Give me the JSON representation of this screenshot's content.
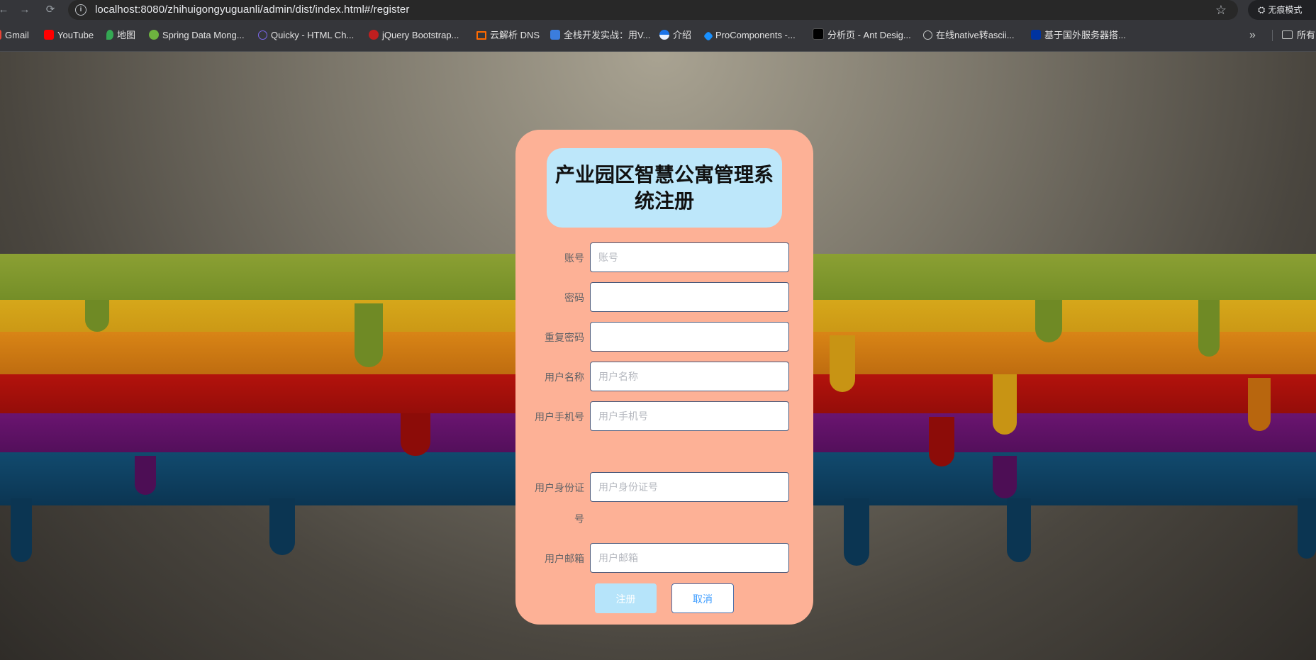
{
  "browser": {
    "url": "localhost:8080/zhihuigongyuguanli/admin/dist/index.html#/register",
    "incognito_label": "无痕模式",
    "bookmarks": [
      {
        "label": "Gmail",
        "icon": "gmail-icon",
        "color": "#ea4335"
      },
      {
        "label": "YouTube",
        "icon": "youtube-icon",
        "color": "#ff0000"
      },
      {
        "label": "地图",
        "icon": "maps-icon",
        "color": "#34a853"
      },
      {
        "label": "Spring Data Mong...",
        "icon": "spring-icon",
        "color": "#6db33f"
      },
      {
        "label": "Quicky - HTML Ch...",
        "icon": "quicky-icon",
        "color": "#6f42c1"
      },
      {
        "label": "jQuery Bootstrap...",
        "icon": "jquery-icon",
        "color": "#c01f1f"
      },
      {
        "label": "云解析 DNS",
        "icon": "aliyun-icon",
        "color": "#ff6a00"
      },
      {
        "label": "全栈开发实战：用V...",
        "icon": "m-icon",
        "color": "#3b7ddd"
      },
      {
        "label": "介绍",
        "icon": "globe-blue-icon",
        "color": "#1a73e8"
      },
      {
        "label": "ProComponents -...",
        "icon": "antd-icon",
        "color": "#1890ff"
      },
      {
        "label": "分析页 - Ant Desig...",
        "icon": "pro-icon",
        "color": "#000000"
      },
      {
        "label": "在线native转ascii...",
        "icon": "globe-icon",
        "color": "#9aa0a6"
      },
      {
        "label": "基于国外服务器搭...",
        "icon": "flag-icon",
        "color": "#0033a0"
      }
    ],
    "bookmarks_folder": "所有"
  },
  "form": {
    "title": "产业园区智慧公寓管理系统注册",
    "fields": [
      {
        "label": "账号",
        "placeholder": "账号"
      },
      {
        "label": "密码",
        "placeholder": ""
      },
      {
        "label": "重复密码",
        "placeholder": ""
      },
      {
        "label": "用户名称",
        "placeholder": "用户名称"
      },
      {
        "label": "用户手机号",
        "placeholder": "用户手机号"
      },
      {
        "label": "用户身份证号",
        "placeholder": "用户身份证号"
      },
      {
        "label": "用户邮箱",
        "placeholder": "用户邮箱"
      }
    ],
    "register_label": "注册",
    "cancel_label": "取消"
  }
}
